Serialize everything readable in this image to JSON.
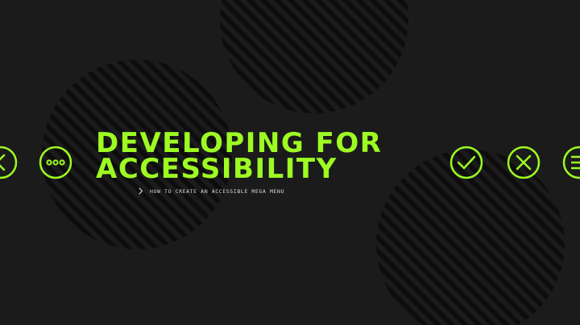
{
  "title": {
    "line1": "DEVELOPING FOR",
    "line2": "ACCESSIBILITY"
  },
  "subtitle": "HOW TO CREATE AN ACCESSIBLE MEGA MENU",
  "colors": {
    "background": "#1b1b1b",
    "accent": "#9dfb22",
    "subtitle": "#dcdcdc",
    "stripe_circle": "#0d0d0d"
  },
  "icons": [
    "chevron-left-icon",
    "more-dots-icon",
    "check-circle-icon",
    "close-circle-icon",
    "menu-lines-icon",
    "chevron-right-icon"
  ]
}
